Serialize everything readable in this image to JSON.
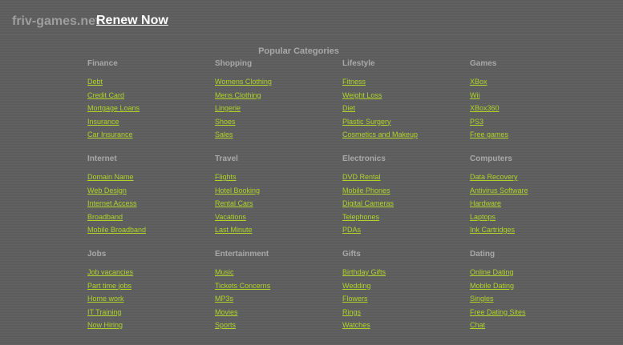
{
  "header": {
    "domain": "friv-games.net",
    "renew_label": "Renew Now"
  },
  "section_title": "Popular Categories",
  "categories": [
    {
      "title": "Finance",
      "links": [
        "Debt",
        "Credit Card",
        "Mortgage Loans",
        "Insurance",
        "Car Insurance"
      ]
    },
    {
      "title": "Shopping",
      "links": [
        "Womens Clothing",
        "Mens Clothing",
        "Lingerie",
        "Shoes",
        "Sales"
      ]
    },
    {
      "title": "Lifestyle",
      "links": [
        "Fitness",
        "Weight Loss",
        "Diet",
        "Plastic Surgery",
        "Cosmetics and Makeup"
      ]
    },
    {
      "title": "Games",
      "links": [
        "XBox",
        "Wii",
        "XBox360",
        "PS3",
        "Free games"
      ]
    },
    {
      "title": "Internet",
      "links": [
        "Domain Name",
        "Web Design",
        "Internet Access",
        "Broadband",
        "Mobile Broadband"
      ]
    },
    {
      "title": "Travel",
      "links": [
        "Flights",
        "Hotel Booking",
        "Rental Cars",
        "Vacations",
        "Last Minute"
      ]
    },
    {
      "title": "Electronics",
      "links": [
        "DVD Rental",
        "Mobile Phones",
        "Digital Cameras",
        "Telephones",
        "PDAs"
      ]
    },
    {
      "title": "Computers",
      "links": [
        "Data Recovery",
        "Antivirus Software",
        "Hardware",
        "Laptops",
        "Ink Cartridges"
      ]
    },
    {
      "title": "Jobs",
      "links": [
        "Job vacancies",
        "Part time jobs",
        "Home work",
        "IT Training",
        "Now Hiring"
      ]
    },
    {
      "title": "Entertainment",
      "links": [
        "Music",
        "Tickets Concerns",
        "MP3s",
        "Movies",
        "Sports"
      ]
    },
    {
      "title": "Gifts",
      "links": [
        "Birthday Gifts",
        "Wedding",
        "Flowers",
        "Rings",
        "Watches"
      ]
    },
    {
      "title": "Dating",
      "links": [
        "Online Dating",
        "Mobile Dating",
        "Singles",
        "Free Dating Sites",
        "Chat"
      ]
    }
  ],
  "colors": {
    "background": "#616161",
    "link": "#b0d22a",
    "heading": "#a8a8a8",
    "renew": "#ffffff"
  }
}
